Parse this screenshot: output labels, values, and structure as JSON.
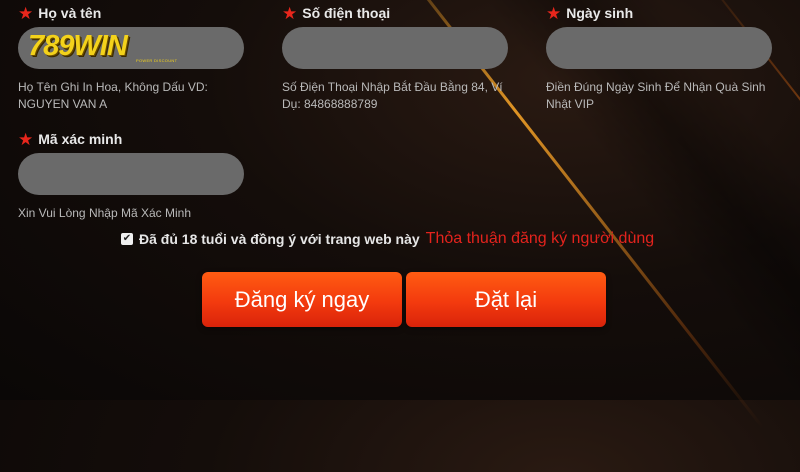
{
  "logo": {
    "text": "789WIN",
    "tagline": "POWER DISCOUNT"
  },
  "fields": {
    "full_name": {
      "label": "Họ và tên",
      "value": "",
      "hint": "Họ Tên Ghi In Hoa, Không Dấu VD: NGUYEN VAN A"
    },
    "phone": {
      "label": "Số điện thoại",
      "value": "",
      "hint": "Số Điện Thoại Nhập Bắt Đầu Bằng 84, Ví Dụ: 84868888789"
    },
    "birthday": {
      "label": "Ngày sinh",
      "value": "",
      "hint": "Điền Đúng Ngày Sinh Để Nhận Quà Sinh Nhật VIP"
    },
    "captcha": {
      "label": "Mã xác minh",
      "value": "",
      "hint": "Xin Vui Lòng Nhập Mã Xác Minh"
    }
  },
  "agreement": {
    "checked": true,
    "text": "Đã đủ 18 tuổi và đồng ý với trang web này",
    "link": "Thỏa thuận đăng ký người dùng"
  },
  "buttons": {
    "register": "Đăng ký ngay",
    "reset": "Đặt lại"
  },
  "colors": {
    "accent": "#f33a0e",
    "required_star": "#e8261c",
    "link": "#e3231d",
    "input_bg": "#6a6a6a"
  }
}
